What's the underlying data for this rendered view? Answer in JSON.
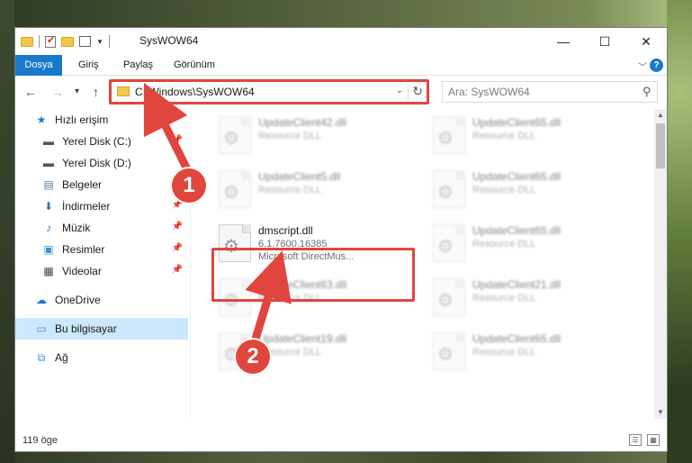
{
  "window": {
    "title": "SysWOW64",
    "controls": {
      "minimize": "—",
      "maximize": "☐",
      "close": "✕"
    }
  },
  "ribbon": {
    "tabs": [
      "Dosya",
      "Giriş",
      "Paylaş",
      "Görünüm"
    ],
    "help_label": "?"
  },
  "nav": {
    "back": "←",
    "forward": "→",
    "recent": "▾",
    "up": "↑",
    "address": "C:\\Windows\\SysWOW64",
    "search_placeholder": "Ara: SysWOW64"
  },
  "sidebar": {
    "items": [
      {
        "label": "Hızlı erişim",
        "icon": "star-icon",
        "glyph": "★",
        "color": "#1979ca"
      },
      {
        "label": "Yerel Disk (C:)",
        "icon": "drive-icon",
        "glyph": "▬",
        "color": "#555555",
        "pinned": true
      },
      {
        "label": "Yerel Disk (D:)",
        "icon": "drive-icon",
        "glyph": "▬",
        "color": "#555555"
      },
      {
        "label": "Belgeler",
        "icon": "documents-icon",
        "glyph": "▤",
        "color": "#5b7ca6"
      },
      {
        "label": "İndirmeler",
        "icon": "download-icon",
        "glyph": "⬇",
        "color": "#1979ca",
        "pinned": true
      },
      {
        "label": "Müzik",
        "icon": "music-icon",
        "glyph": "♪",
        "color": "#1979ca",
        "pinned": true
      },
      {
        "label": "Resimler",
        "icon": "pictures-icon",
        "glyph": "▣",
        "color": "#3a8fd0",
        "pinned": true
      },
      {
        "label": "Videolar",
        "icon": "videos-icon",
        "glyph": "▦",
        "color": "#444444",
        "pinned": true
      },
      {
        "label": "OneDrive",
        "icon": "cloud-icon",
        "glyph": "☁",
        "color": "#1979ca"
      },
      {
        "label": "Bu bilgisayar",
        "icon": "computer-icon",
        "glyph": "▭",
        "color": "#3a8fd0",
        "selected": true
      },
      {
        "label": "Ağ",
        "icon": "network-icon",
        "glyph": "⧉",
        "color": "#3a8fd0"
      }
    ]
  },
  "files": [
    {
      "name": "UpdateClient42.dll",
      "line2": "Resource DLL"
    },
    {
      "name": "UpdateClient65.dll",
      "line2": "Resource DLL"
    },
    {
      "name": "UpdateClient5.dll",
      "line2": "Resource DLL"
    },
    {
      "name": "UpdateClient65.dll",
      "line2": "Resource DLL"
    },
    {
      "name": "dmscript.dll",
      "line2": "6.1.7600.16385",
      "line3": "Microsoft DirectMus..."
    },
    {
      "name": "UpdateClient65.dll",
      "line2": "Resource DLL"
    },
    {
      "name": "UpdateClient63.dll",
      "line2": "Resource DLL"
    },
    {
      "name": "UpdateClient21.dll",
      "line2": "Resource DLL"
    },
    {
      "name": "UpdateClient19.dll",
      "line2": "Resource DLL"
    },
    {
      "name": "UpdateClient65.dll",
      "line2": "Resource DLL"
    }
  ],
  "status": {
    "count": "119 öge"
  },
  "callouts": [
    "1",
    "2"
  ],
  "colors": {
    "accent": "#1979ca",
    "highlight": "#e0463e"
  }
}
